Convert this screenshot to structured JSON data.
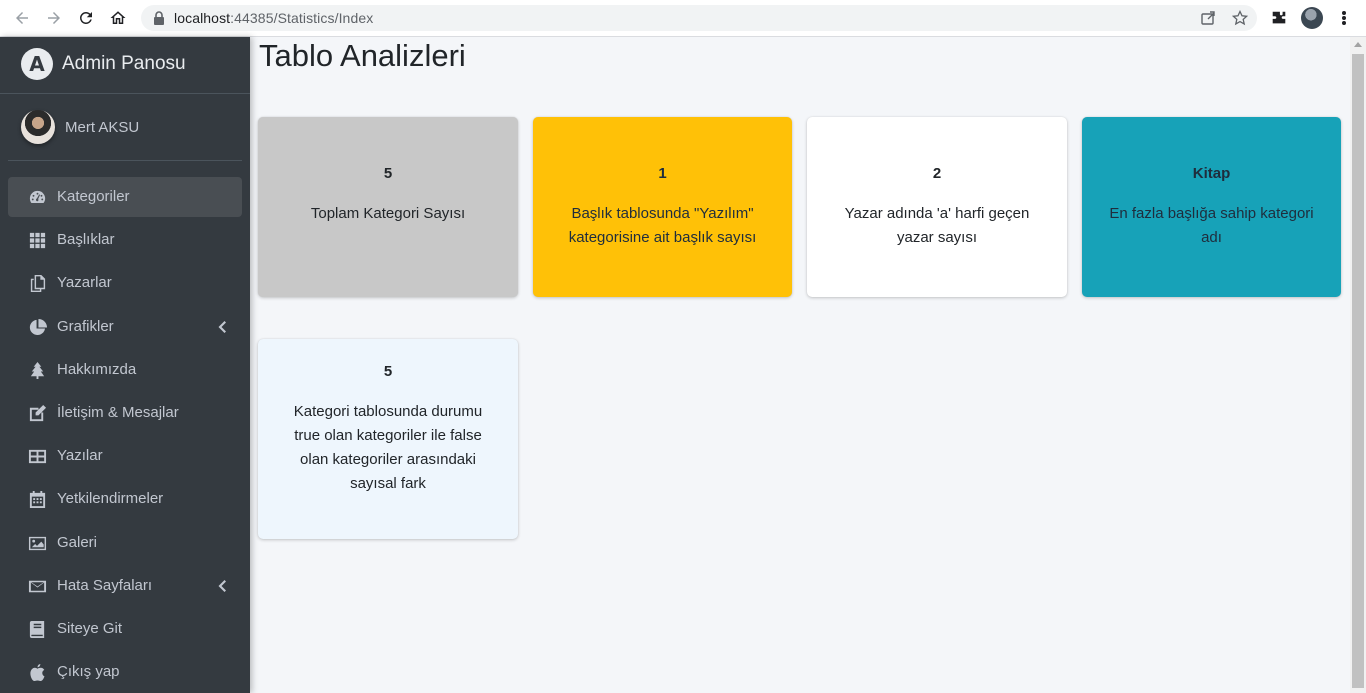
{
  "browser": {
    "url_host": "localhost",
    "url_path": ":44385/Statistics/Index"
  },
  "sidebar": {
    "brand": "Admin Panosu",
    "brand_logo_letter": "A",
    "user_name": "Mert AKSU",
    "items": [
      {
        "label": "Kategoriler",
        "icon": "tachometer-icon",
        "active": true
      },
      {
        "label": "Başlıklar",
        "icon": "grid-icon"
      },
      {
        "label": "Yazarlar",
        "icon": "copy-icon"
      },
      {
        "label": "Grafikler",
        "icon": "pie-chart-icon",
        "has_caret": true
      },
      {
        "label": "Hakkımızda",
        "icon": "tree-icon"
      },
      {
        "label": "İletişim & Mesajlar",
        "icon": "edit-icon"
      },
      {
        "label": "Yazılar",
        "icon": "table-icon"
      },
      {
        "label": "Yetkilendirmeler",
        "icon": "calendar-icon"
      },
      {
        "label": "Galeri",
        "icon": "image-icon"
      },
      {
        "label": "Hata Sayfaları",
        "icon": "envelope-icon",
        "has_caret": true
      },
      {
        "label": "Siteye Git",
        "icon": "book-icon"
      },
      {
        "label": "Çıkış yap",
        "icon": "apple-icon"
      }
    ]
  },
  "main": {
    "title": "Tablo Analizleri",
    "cards": [
      {
        "value": "5",
        "text": "Toplam Kategori Sayısı",
        "bg": "#c8c8c8",
        "fg": "#212529"
      },
      {
        "value": "1",
        "text": "Başlık tablosunda \"Yazılım\" kategorisine ait başlık sayısı",
        "bg": "#ffc107",
        "fg": "#1f2d3d"
      },
      {
        "value": "2",
        "text": "Yazar adında 'a' harfi geçen yazar sayısı",
        "bg": "#ffffff",
        "fg": "#212529"
      },
      {
        "value": "Kitap",
        "text": "En fazla başlığa sahip kategori adı",
        "bg": "#17a2b8",
        "fg": "#1f2d3d"
      },
      {
        "value": "5",
        "text": "Kategori tablosunda durumu true olan kategoriler ile false olan kategoriler arasındaki sayısal fark",
        "bg": "#eef6fd",
        "fg": "#212529"
      }
    ]
  }
}
